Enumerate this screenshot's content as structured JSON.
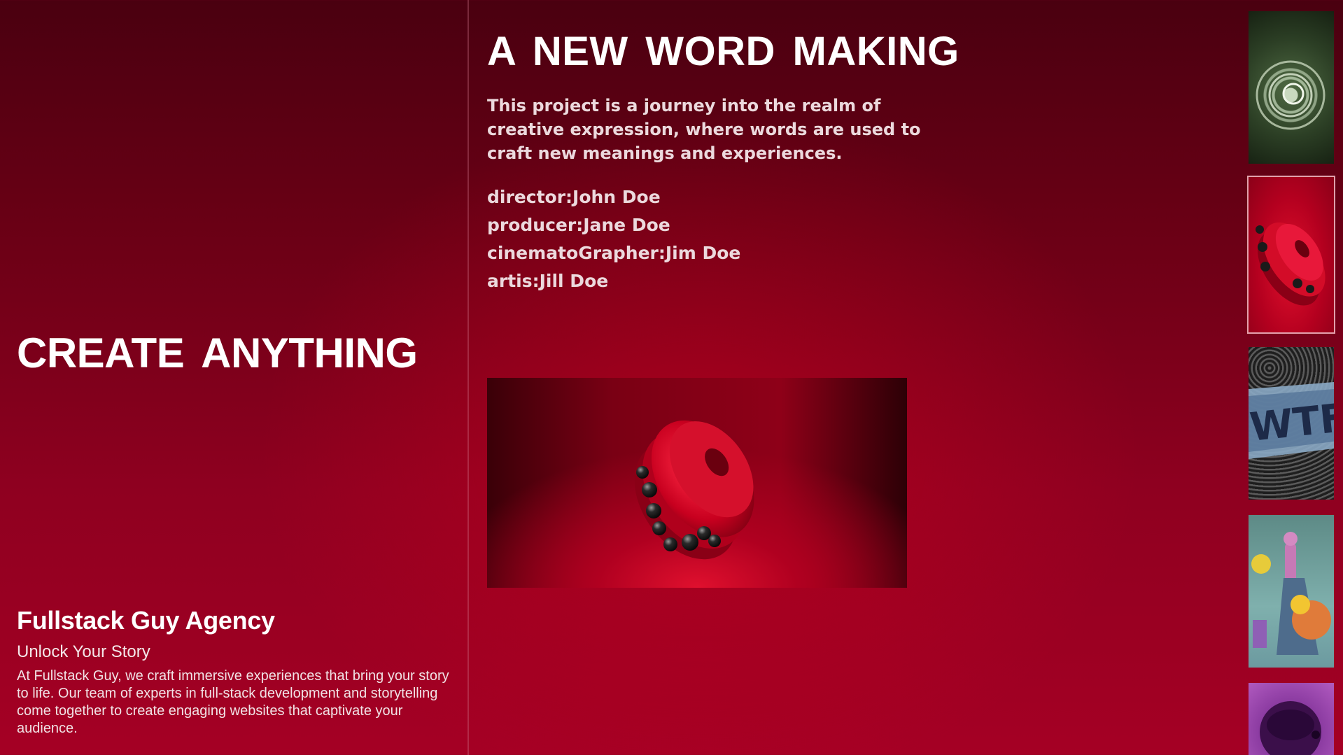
{
  "hero": {
    "title": "CREATE ANYTHING"
  },
  "agency": {
    "name": "Fullstack Guy Agency",
    "tagline": "Unlock Your Story",
    "description": "At Fullstack Guy, we craft immersive experiences that bring your story to life. Our team of experts in full-stack development and storytelling come together to create engaging websites that captivate your audience."
  },
  "project": {
    "title": "A NEW WORD MAKING",
    "description": "This project is a journey into the realm of creative expression, where words are used to craft new meanings and experiences.",
    "credits": [
      "director:John Doe",
      "producer:Jane Doe",
      "cinematoGrapher:Jim Doe",
      "artis:Jill Doe"
    ]
  },
  "thumbnails": [
    {
      "icon": "spiral-artwork-thumbnail"
    },
    {
      "icon": "red-torus-thumbnail"
    },
    {
      "icon": "wtf-glitch-thumbnail",
      "text": "WTF"
    },
    {
      "icon": "abstract-shapes-thumbnail"
    },
    {
      "icon": "purple-orb-thumbnail"
    }
  ],
  "colors": {
    "background_top": "#4a0010",
    "background_bottom": "#a50024",
    "accent_red": "#e0102e",
    "text": "#ffffff"
  }
}
